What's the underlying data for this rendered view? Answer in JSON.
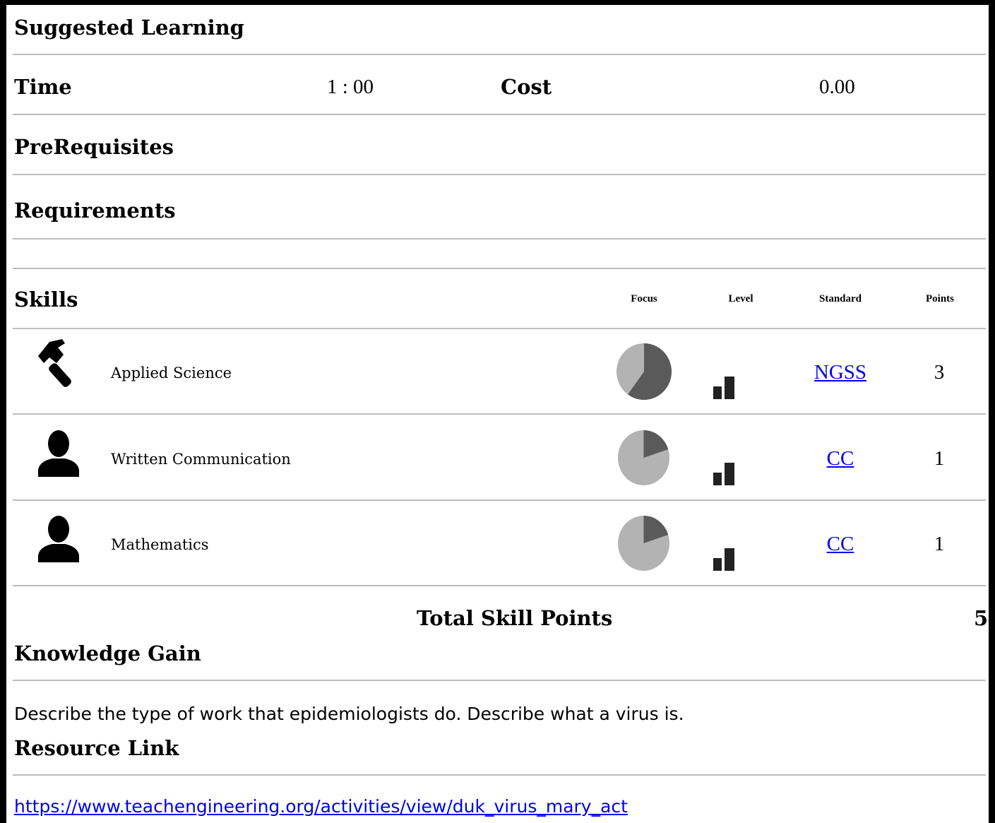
{
  "headings": {
    "suggested_learning": "Suggested Learning",
    "time_label": "Time",
    "time_value": "1 : 00",
    "cost_label": "Cost",
    "cost_value": "0.00",
    "prerequisites": "PreRequisites",
    "requirements": "Requirements",
    "skills": "Skills",
    "knowledge_gain": "Knowledge Gain",
    "resource_link": "Resource Link"
  },
  "skills_table": {
    "columns": [
      "Focus",
      "Level",
      "Standard",
      "Points"
    ],
    "rows": [
      {
        "icon": "hammer-icon",
        "name": "Applied Science",
        "focus_fraction": 0.6,
        "level_bars": 2,
        "standard": "NGSS",
        "points": "3"
      },
      {
        "icon": "person-icon",
        "name": "Written Communication",
        "focus_fraction": 0.2,
        "level_bars": 2,
        "standard": "CC",
        "points": "1"
      },
      {
        "icon": "person-icon",
        "name": "Mathematics",
        "focus_fraction": 0.2,
        "level_bars": 2,
        "standard": "CC",
        "points": "1"
      }
    ],
    "total_label": "Total Skill Points",
    "total_value": "5"
  },
  "knowledge_text": "Describe the type of work that epidemiologists do. Describe what a virus is.",
  "resource_url": "https://www.teachengineering.org/activities/view/duk_virus_mary_act",
  "colors": {
    "pie_dark": "#5a5a5a",
    "pie_light": "#b3b3b3",
    "link": "#0000ee",
    "rule": "#bdbdbd"
  }
}
